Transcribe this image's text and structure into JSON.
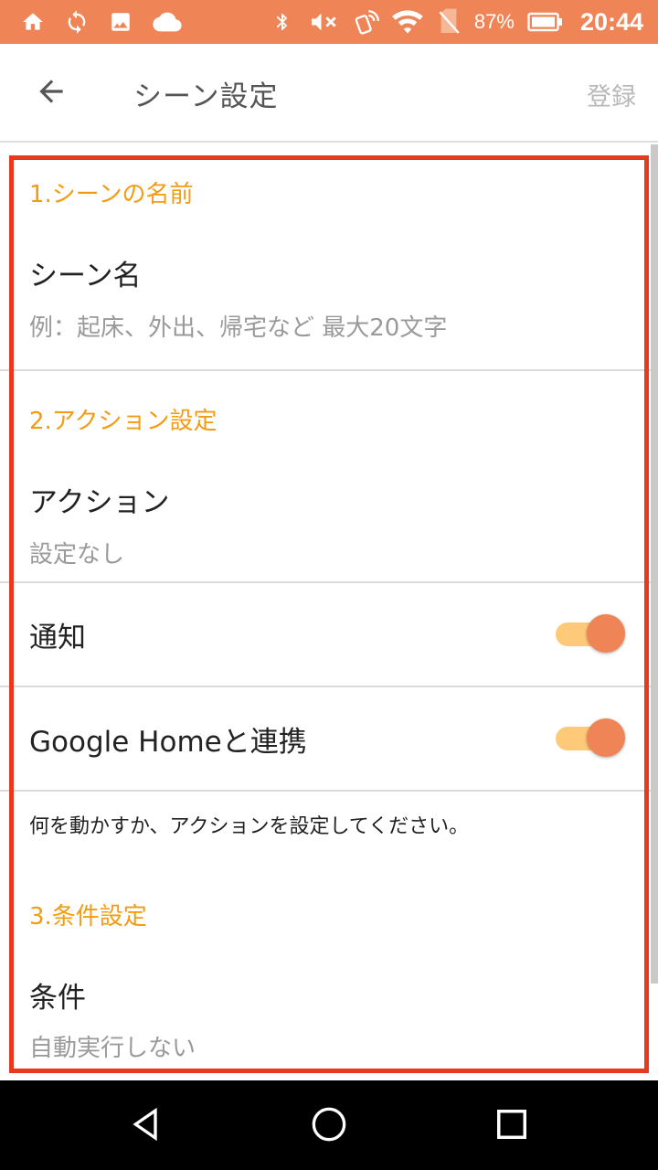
{
  "status_bar": {
    "battery_percent": "87%",
    "time": "20:44",
    "background_color": "#ef8556",
    "left_icons": [
      "home-icon",
      "sync-icon",
      "image-icon",
      "cloud-icon"
    ],
    "right_icons": [
      "bluetooth-icon",
      "mute-icon",
      "nfc-icon",
      "wifi-icon",
      "no-sim-icon",
      "battery-icon"
    ]
  },
  "app_bar": {
    "back_icon": "arrow-left-icon",
    "title": "シーン設定",
    "register_label": "登録"
  },
  "sections": {
    "scene_name": {
      "header": "1.シーンの名前",
      "row_title": "シーン名",
      "row_hint": "例：起床、外出、帰宅など 最大20文字"
    },
    "action": {
      "header": "2.アクション設定",
      "action_title": "アクション",
      "action_value": "設定なし",
      "notify_label": "通知",
      "notify_on": true,
      "google_home_label": "Google Homeと連携",
      "google_home_on": true,
      "note": "何を動かすか、アクションを設定してください。"
    },
    "condition": {
      "header": "3.条件設定",
      "row_title": "条件",
      "row_value": "自動実行しない"
    }
  },
  "colors": {
    "accent": "#ef8556",
    "section_header": "#f39c12",
    "toggle_track": "#ffc97a",
    "highlight_frame": "#e8391e"
  },
  "nav_bar": {
    "icons": [
      "back-triangle-icon",
      "home-circle-icon",
      "recents-square-icon"
    ]
  }
}
